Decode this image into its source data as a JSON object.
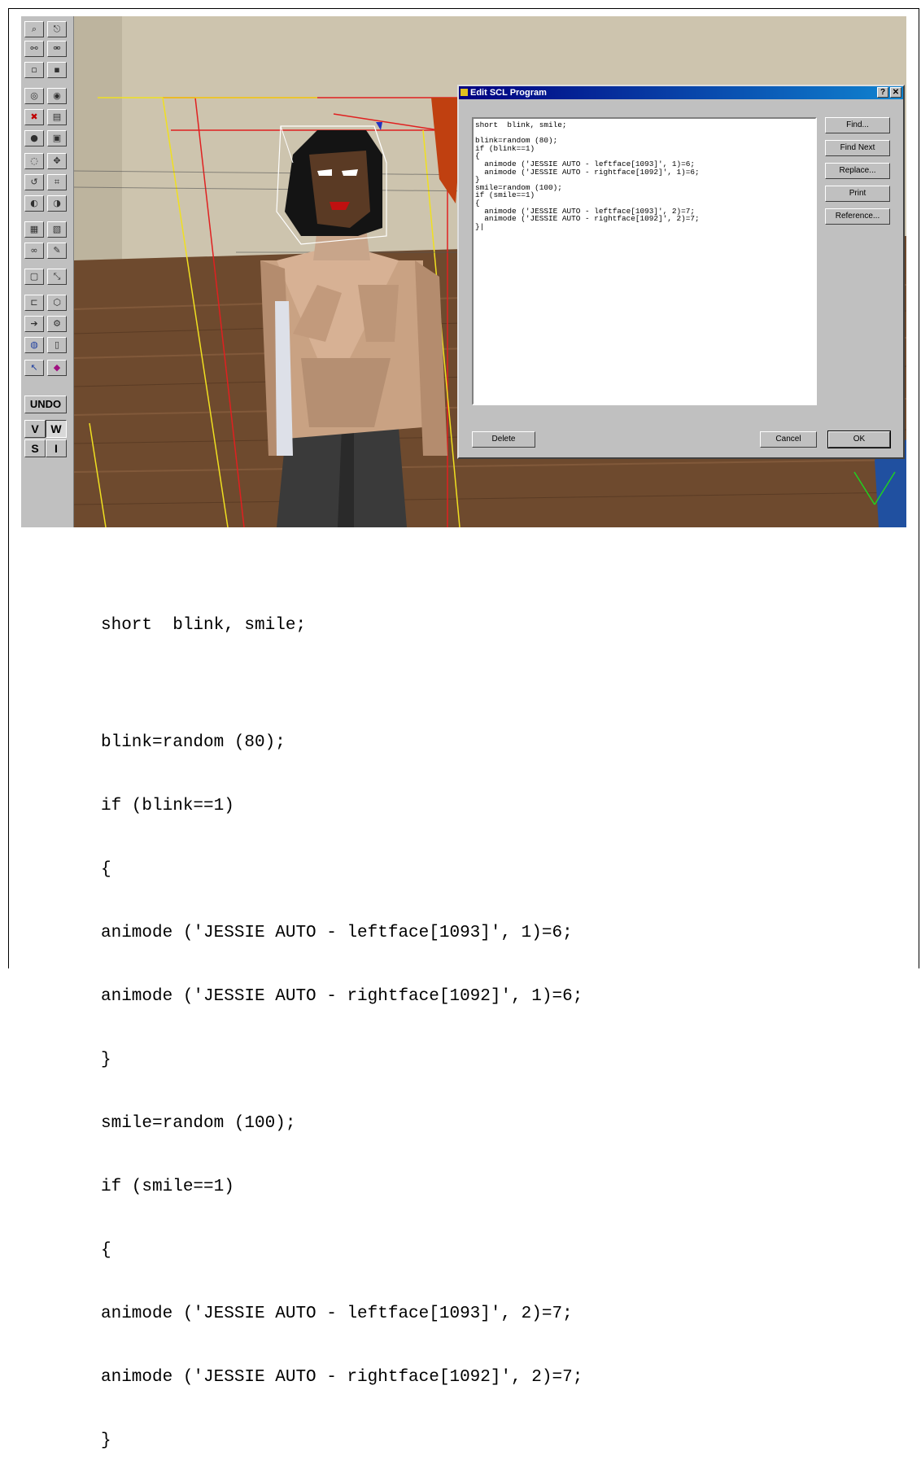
{
  "toolbar": {
    "undo_label": "UNDO",
    "view_buttons": [
      "V",
      "W",
      "S",
      "I"
    ]
  },
  "dialog": {
    "title": "Edit SCL Program",
    "help_btn": "?",
    "close_btn": "✕",
    "editor_text": "short  blink, smile;\n\nblink=random (80);\nif (blink==1)\n{\n  animode ('JESSIE AUTO - leftface[1093]', 1)=6;\n  animode ('JESSIE AUTO - rightface[1092]', 1)=6;\n}\nsmile=random (100);\nif (smile==1)\n{\n  animode ('JESSIE AUTO - leftface[1093]', 2)=7;\n  animode ('JESSIE AUTO - rightface[1092]', 2)=7;\n}|",
    "buttons": {
      "find": "Find...",
      "find_next": "Find Next",
      "replace": "Replace...",
      "print": "Print",
      "reference": "Reference...",
      "delete": "Delete",
      "cancel": "Cancel",
      "ok": "OK"
    }
  },
  "listing": {
    "line1": "short  blink, smile;",
    "line2": "blink=random (80);",
    "line3": "if (blink==1)",
    "line4": "{",
    "line5": "animode ('JESSIE AUTO - leftface[1093]', 1)=6;",
    "line6": "animode ('JESSIE AUTO - rightface[1092]', 1)=6;",
    "line7": "}",
    "line8": "smile=random (100);",
    "line9": "if (smile==1)",
    "line10": "{",
    "line11": "animode ('JESSIE AUTO - leftface[1093]', 2)=7;",
    "line12": "animode ('JESSIE AUTO - rightface[1092]', 2)=7;",
    "line13": "}"
  }
}
